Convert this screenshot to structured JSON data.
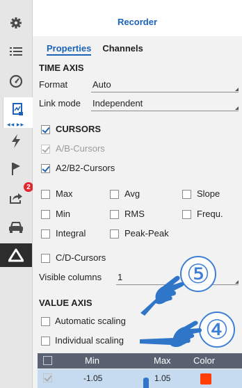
{
  "sidebar": {
    "items": [
      {
        "icon": "gear-icon"
      },
      {
        "icon": "list-icon"
      },
      {
        "icon": "gauge-icon"
      },
      {
        "icon": "recorder-icon",
        "active": true
      },
      {
        "icon": "lightning-icon"
      },
      {
        "icon": "flag-icon"
      },
      {
        "icon": "export-icon"
      },
      {
        "icon": "car-icon"
      },
      {
        "icon": "alert-triangle-icon",
        "badge": "2"
      }
    ]
  },
  "panel": {
    "title": "Recorder",
    "tabs": [
      "Properties",
      "Channels"
    ]
  },
  "time_axis": {
    "heading": "TIME AXIS",
    "format_label": "Format",
    "format_value": "Auto",
    "link_label": "Link mode",
    "link_value": "Independent"
  },
  "cursors": {
    "heading": "CURSORS",
    "ab": "A/B-Cursors",
    "a2b2": "A2/B2-Cursors",
    "options": {
      "max": "Max",
      "avg": "Avg",
      "slope": "Slope",
      "min": "Min",
      "rms": "RMS",
      "frequ": "Frequ.",
      "integral": "Integral",
      "peakpeak": "Peak-Peak"
    },
    "cd": "C/D-Cursors",
    "visible_label": "Visible columns",
    "visible_value": "1"
  },
  "value_axis": {
    "heading": "VALUE AXIS",
    "auto": "Automatic scaling",
    "individual": "Individual scaling"
  },
  "table": {
    "headers": {
      "min": "Min",
      "max": "Max",
      "color": "Color"
    },
    "rows": [
      {
        "min": "-1.05",
        "max": "1.05",
        "color": "#ff3d06"
      }
    ]
  },
  "annotations": {
    "five": "⑤",
    "four": "④"
  },
  "colors": {
    "accent": "#1a63b8",
    "header_bg": "#5a6272",
    "row_bg": "#c6daf0"
  }
}
